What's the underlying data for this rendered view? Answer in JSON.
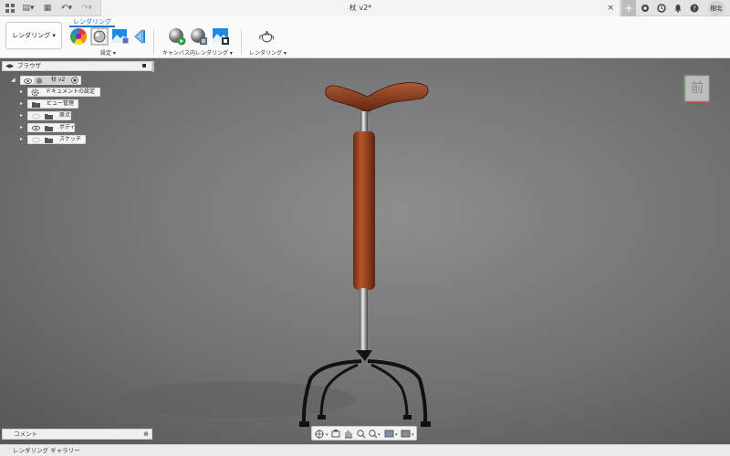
{
  "document": {
    "title": "杖 v2*",
    "close": "×"
  },
  "quick_access": {
    "file": "▤▾",
    "save": "▦",
    "undo": "↶▾",
    "redo": "↷▾"
  },
  "right_tools": {
    "add": "+",
    "user": "樹北"
  },
  "toolbar": {
    "workspace_button": "レンダリング ▾",
    "workspace_tab": "レンダリング",
    "groups": [
      {
        "label": "設定 ▾"
      },
      {
        "label": "キャンバス内レンダリング ▾"
      },
      {
        "label": "レンダリング ▾"
      }
    ]
  },
  "browser": {
    "title": "ブラウザ",
    "items": [
      {
        "label": "杖 v2"
      },
      {
        "label": "ドキュメントの設定"
      },
      {
        "label": "ビュー管理"
      },
      {
        "label": "原点"
      },
      {
        "label": "ボディ"
      },
      {
        "label": "スケッチ"
      }
    ]
  },
  "viewcube": {
    "face": "前"
  },
  "comments": {
    "label": "コメント",
    "add": "⊕"
  },
  "gallery": {
    "label": "レンダリング ギャラリー"
  },
  "colors": {
    "accent": "#1b77c5",
    "wood": "#8a3a20",
    "viewport": "#777777"
  }
}
